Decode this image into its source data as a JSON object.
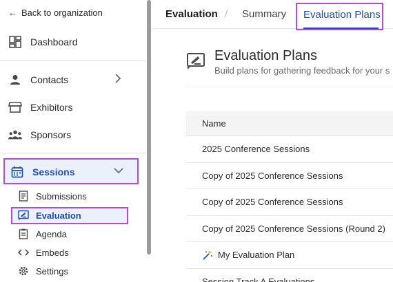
{
  "sidebar": {
    "back_label": "Back to organization",
    "items": [
      {
        "label": "Dashboard",
        "icon": "dashboard-icon"
      },
      {
        "label": "Contacts",
        "icon": "person-icon"
      },
      {
        "label": "Exhibitors",
        "icon": "storefront-icon"
      },
      {
        "label": "Sponsors",
        "icon": "group-icon"
      },
      {
        "label": "Sessions",
        "icon": "calendar-icon"
      }
    ],
    "sub_items": [
      {
        "label": "Submissions",
        "icon": "document-icon"
      },
      {
        "label": "Evaluation",
        "icon": "evaluation-icon"
      },
      {
        "label": "Agenda",
        "icon": "agenda-icon"
      },
      {
        "label": "Embeds",
        "icon": "code-icon"
      },
      {
        "label": "Settings",
        "icon": "gear-icon"
      }
    ]
  },
  "tabs": {
    "evaluation": "Evaluation",
    "separator": "/",
    "summary": "Summary",
    "plans": "Evaluation Plans"
  },
  "header": {
    "title": "Evaluation Plans",
    "subtitle": "Build plans for gathering feedback for your s"
  },
  "table": {
    "header": "Name",
    "rows": [
      "2025 Conference Sessions",
      "Copy of 2025 Conference Sessions",
      "Copy of 2025 Conference Sessions",
      "Copy of 2025 Conference Sessions (Round 2)",
      "My Evaluation Plan",
      "Session Track A Evaluations"
    ]
  },
  "colors": {
    "accent": "#1f4fb5",
    "highlight_border": "#b44bd6",
    "selected_bg": "#eaf1fb"
  }
}
